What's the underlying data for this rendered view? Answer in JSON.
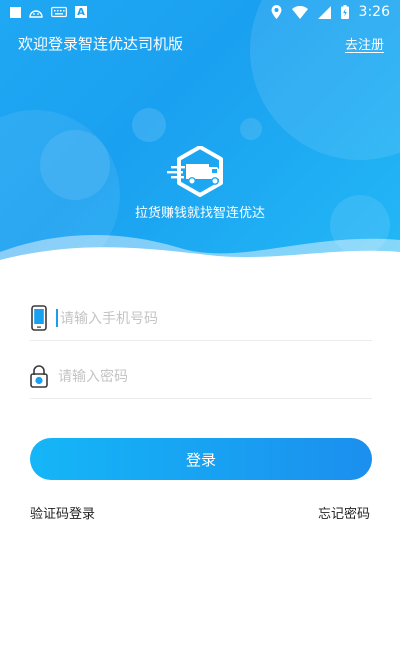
{
  "status_bar": {
    "time": "3:26",
    "notification_text_icon": "A",
    "icons": [
      "square-notification-icon",
      "android-icon",
      "keyboard-icon",
      "text-notification-icon",
      "location-icon",
      "wifi-icon",
      "signal-icon",
      "battery-icon"
    ]
  },
  "header": {
    "title": "欢迎登录智连优达司机版",
    "register_link": "去注册"
  },
  "hero": {
    "slogan": "拉货赚钱就找智连优达",
    "logo_icon": "truck-hexagon-logo-icon"
  },
  "form": {
    "phone_placeholder": "请输入手机号码",
    "password_placeholder": "请输入密码",
    "phone_icon": "mobile-phone-icon",
    "password_icon": "lock-icon"
  },
  "actions": {
    "login_label": "登录",
    "sms_login_label": "验证码登录",
    "forgot_password_label": "忘记密码"
  },
  "colors": {
    "primary": "#1aa0f0",
    "gradient_start": "#15b6f7",
    "gradient_end": "#1b8fee",
    "placeholder": "#c4c4c4",
    "divider": "#ececec"
  }
}
